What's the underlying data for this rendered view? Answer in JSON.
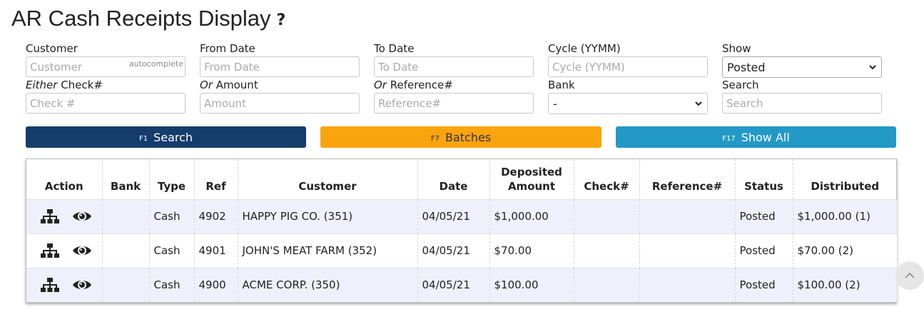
{
  "page": {
    "title": "AR Cash Receipts Display",
    "help_glyph": "?"
  },
  "filters": {
    "customer": {
      "label": "Customer",
      "placeholder": "Customer",
      "value": "",
      "hint": "autocomplete"
    },
    "from_date": {
      "label": "From Date",
      "placeholder": "From Date",
      "value": ""
    },
    "to_date": {
      "label": "To Date",
      "placeholder": "To Date",
      "value": ""
    },
    "cycle": {
      "label": "Cycle (YYMM)",
      "placeholder": "Cycle (YYMM)",
      "value": ""
    },
    "show": {
      "label": "Show",
      "selected": "Posted"
    },
    "check": {
      "label_prefix": "Either",
      "label": " Check#",
      "placeholder": "Check #",
      "value": ""
    },
    "amount": {
      "label_prefix": "Or",
      "label": " Amount",
      "placeholder": "Amount",
      "value": ""
    },
    "reference": {
      "label_prefix": "Or",
      "label": " Reference#",
      "placeholder": "Reference#",
      "value": ""
    },
    "bank": {
      "label": "Bank",
      "selected": "-"
    },
    "search": {
      "label": "Search",
      "placeholder": "Search",
      "value": ""
    }
  },
  "buttons": {
    "search": {
      "fkey": "F1",
      "label": "Search",
      "color": "#153d6b"
    },
    "batches": {
      "fkey": "F7",
      "label": "Batches",
      "color": "#f9a40d"
    },
    "show_all": {
      "fkey": "F17",
      "label": "Show All",
      "color": "#2399c7"
    }
  },
  "table": {
    "headers": {
      "action": "Action",
      "bank": "Bank",
      "type": "Type",
      "ref": "Ref",
      "customer": "Customer",
      "date": "Date",
      "deposited_line1": "Deposited",
      "deposited_line2": "Amount",
      "check": "Check#",
      "reference": "Reference#",
      "status": "Status",
      "distributed": "Distributed"
    },
    "rows": [
      {
        "bank": "",
        "type": "Cash",
        "ref": "4902",
        "customer": "HAPPY PIG CO. (351)",
        "date": "04/05/21",
        "deposited": "$1,000.00",
        "check": "",
        "reference": "",
        "status": "Posted",
        "distributed": "$1,000.00 (1)"
      },
      {
        "bank": "",
        "type": "Cash",
        "ref": "4901",
        "customer": "JOHN'S MEAT FARM (352)",
        "date": "04/05/21",
        "deposited": "$70.00",
        "check": "",
        "reference": "",
        "status": "Posted",
        "distributed": "$70.00 (2)"
      },
      {
        "bank": "",
        "type": "Cash",
        "ref": "4900",
        "customer": "ACME CORP. (350)",
        "date": "04/05/21",
        "deposited": "$100.00",
        "check": "",
        "reference": "",
        "status": "Posted",
        "distributed": "$100.00 (2)"
      }
    ],
    "row_icons": [
      "hierarchy-icon",
      "eye-icon"
    ],
    "stripe_color": "#eff0fb"
  }
}
